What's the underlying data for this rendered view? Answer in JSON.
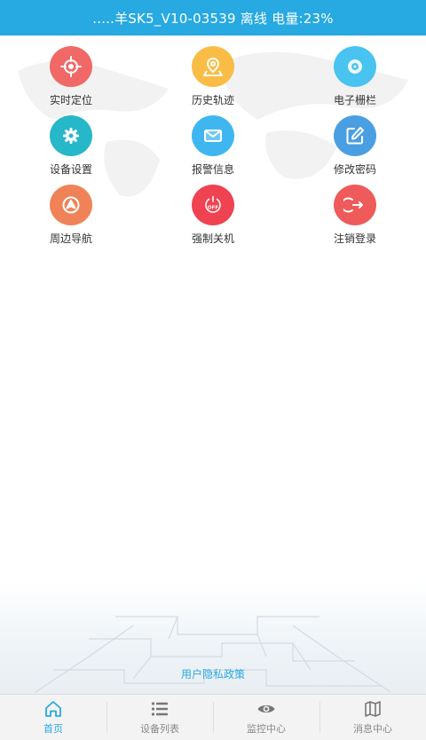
{
  "header": {
    "title": ".....羊SK5_V10-03539 离线 电量:23%"
  },
  "grid": [
    {
      "label": "实时定位",
      "icon": "crosshair-icon",
      "color": "#f06966"
    },
    {
      "label": "历史轨迹",
      "icon": "map-pin-icon",
      "color": "#f9bd46"
    },
    {
      "label": "电子栅栏",
      "icon": "target-icon",
      "color": "#49c3f0"
    },
    {
      "label": "设备设置",
      "icon": "gear-icon",
      "color": "#26b7c9"
    },
    {
      "label": "报警信息",
      "icon": "mail-icon",
      "color": "#3fb6ef"
    },
    {
      "label": "修改密码",
      "icon": "edit-icon",
      "color": "#4a9fe3"
    },
    {
      "label": "周边导航",
      "icon": "navigation-icon",
      "color": "#f08258"
    },
    {
      "label": "强制关机",
      "icon": "power-off-icon",
      "color": "#ef4351",
      "badge": "OFF"
    },
    {
      "label": "注销登录",
      "icon": "logout-icon",
      "color": "#ef5a5a"
    }
  ],
  "footer": {
    "policy_link": "用户隐私政策"
  },
  "tabs": [
    {
      "label": "首页",
      "icon": "home-icon",
      "active": true
    },
    {
      "label": "设备列表",
      "icon": "list-icon",
      "active": false
    },
    {
      "label": "监控中心",
      "icon": "eye-icon",
      "active": false
    },
    {
      "label": "消息中心",
      "icon": "map-icon",
      "active": false
    }
  ],
  "colors": {
    "accent": "#27a9e1",
    "inactive_tab": "#888888"
  }
}
